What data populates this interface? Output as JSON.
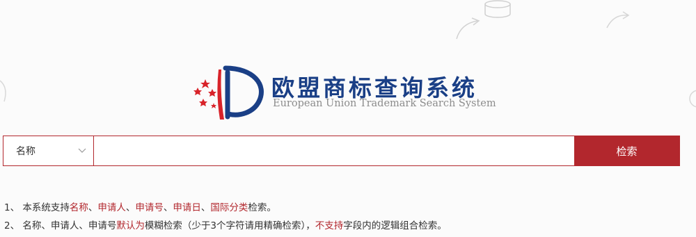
{
  "logo": {
    "title_cn": "欧盟商标查询系统",
    "title_en": "European Union Trademark Search System"
  },
  "search": {
    "type_selected": "名称",
    "input_value": "",
    "placeholder": "",
    "button_label": "检索"
  },
  "notes": {
    "line1": {
      "prefix": "1、 本系统支持",
      "f1": "名称",
      "sep1": "、",
      "f2": "申请人",
      "sep2": "、",
      "f3": "申请号",
      "sep3": "、",
      "f4": "申请日",
      "sep4": "、",
      "f5": "国际分类",
      "suffix": "检索。"
    },
    "line2": {
      "prefix": "2、 名称、申请人、申请号",
      "hl1": "默认为",
      "mid": "模糊检索（少于3个字符请用精确检索），",
      "hl2": "不支持",
      "suffix": "字段内的逻辑组合检索。"
    }
  },
  "colors": {
    "brand_red": "#b2272d",
    "brand_blue": "#1a3f86"
  }
}
